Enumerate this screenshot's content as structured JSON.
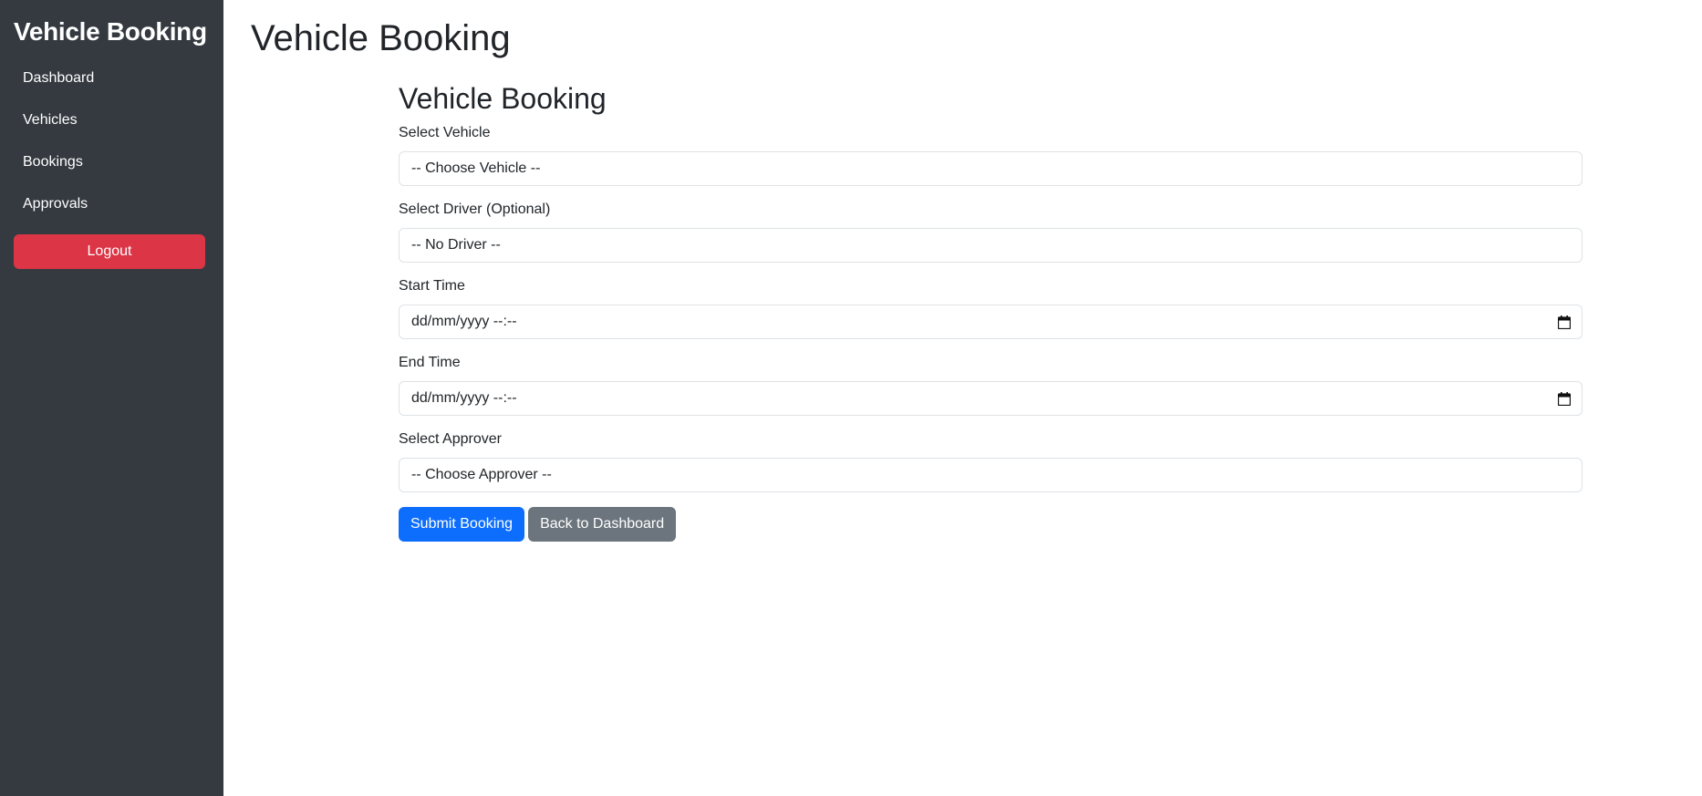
{
  "sidebar": {
    "brand": "Vehicle Booking",
    "items": [
      {
        "label": "Dashboard"
      },
      {
        "label": "Vehicles"
      },
      {
        "label": "Bookings"
      },
      {
        "label": "Approvals"
      }
    ],
    "logout_label": "Logout"
  },
  "main": {
    "page_title": "Vehicle Booking",
    "form": {
      "title": "Vehicle Booking",
      "vehicle": {
        "label": "Select Vehicle",
        "value": "-- Choose Vehicle --"
      },
      "driver": {
        "label": "Select Driver (Optional)",
        "value": "-- No Driver --"
      },
      "start_time": {
        "label": "Start Time",
        "value": "dd/mm/yyyy --:--"
      },
      "end_time": {
        "label": "End Time",
        "value": "dd/mm/yyyy --:--"
      },
      "approver": {
        "label": "Select Approver",
        "value": "-- Choose Approver --"
      },
      "submit_label": "Submit Booking",
      "back_label": "Back to Dashboard"
    }
  },
  "colors": {
    "sidebar_bg": "#343a40",
    "logout": "#dc3545",
    "primary": "#0d6efd",
    "secondary": "#6c757d"
  },
  "icons": {
    "calendar": "calendar-icon"
  }
}
